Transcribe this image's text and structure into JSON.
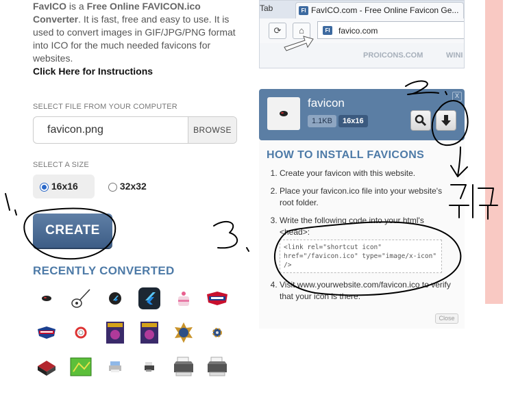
{
  "intro": {
    "brand": "FavICO",
    "text1": " is a ",
    "strong": "Free Online FAVICON.ico Converter",
    "text2": ". It is fast, free and easy to use. It is used to convert images in GIF/JPG/PNG format into ICO for the much needed favicons for websites.",
    "instructions_link": "Click Here for Instructions"
  },
  "upload": {
    "label": "SELECT FILE FROM YOUR COMPUTER",
    "file_value": "favicon.png",
    "browse_label": "BROWSE"
  },
  "size": {
    "label": "SELECT A SIZE",
    "options": [
      {
        "label": "16x16",
        "selected": true
      },
      {
        "label": "32x32",
        "selected": false
      }
    ]
  },
  "create_label": "CREATE",
  "recent": {
    "title": "RECENTLY CONVERTED",
    "icons": [
      "mouse-icon",
      "guitar-icon",
      "flutter-round-icon",
      "flutter-icon",
      "cake-icon",
      "team-logo-icon",
      "team-logo-icon",
      "lifebuoy-icon",
      "game-cover-icon",
      "game-cover-icon",
      "badge-icon",
      "gear-icon",
      "printer-red-icon",
      "map-icon",
      "printer-icon",
      "printer-small-icon",
      "printer-icon",
      "printer-icon"
    ]
  },
  "browser": {
    "tab_left": "Tab",
    "tab_title": "FavICO.com - Free Online Favicon Ge...",
    "favicon_text": "FI",
    "url": "favico.com",
    "bottom_left": "PROICONS.COM",
    "bottom_right": "WINI"
  },
  "result": {
    "name": "favicon",
    "size_badge": "1.1KB",
    "dim_badge": "16x16",
    "close": "X"
  },
  "install": {
    "title": "HOW TO INSTALL FAVICONS",
    "step1": "Create your favicon with this website.",
    "step2": "Place your favicon.ico file into your website's root folder.",
    "step3": "Write the following code into your html's <head>:",
    "code": "<link rel=\"shortcut icon\" href=\"/favicon.ico\" type=\"image/x-icon\" />",
    "step4": "Visit www.yourwebsite.com/favicon.ico to verify that your icon is there.",
    "close_label": "Close"
  },
  "annotations": {
    "one": "1.",
    "two": "2.",
    "three": "3.",
    "click": "클릭"
  },
  "colors": {
    "accent": "#4d7aa7",
    "panel": "#5b7ea4",
    "pink_bar": "#f9c9c3"
  }
}
